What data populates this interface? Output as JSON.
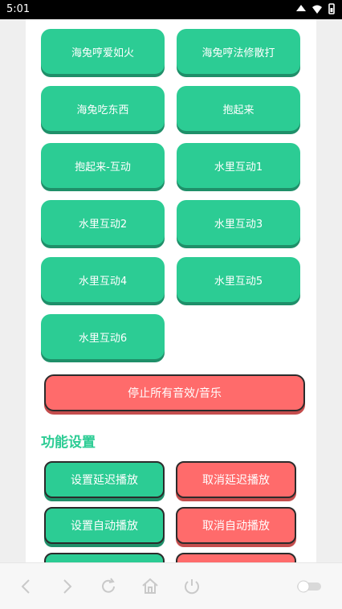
{
  "statusbar": {
    "time": "5:01"
  },
  "sound_buttons": [
    "海兔哼爱如火",
    "海兔哼法修散打",
    "海兔吃东西",
    "抱起来",
    "抱起来-互动",
    "水里互动1",
    "水里互动2",
    "水里互动3",
    "水里互动4",
    "水里互动5",
    "水里互动6"
  ],
  "stop_button": "停止所有音效/音乐",
  "section_title": "功能设置",
  "settings": {
    "set_delay": "设置延迟播放",
    "cancel_delay": "取消延迟播放",
    "set_auto": "设置自动播放",
    "cancel_auto": "取消自动播放"
  }
}
